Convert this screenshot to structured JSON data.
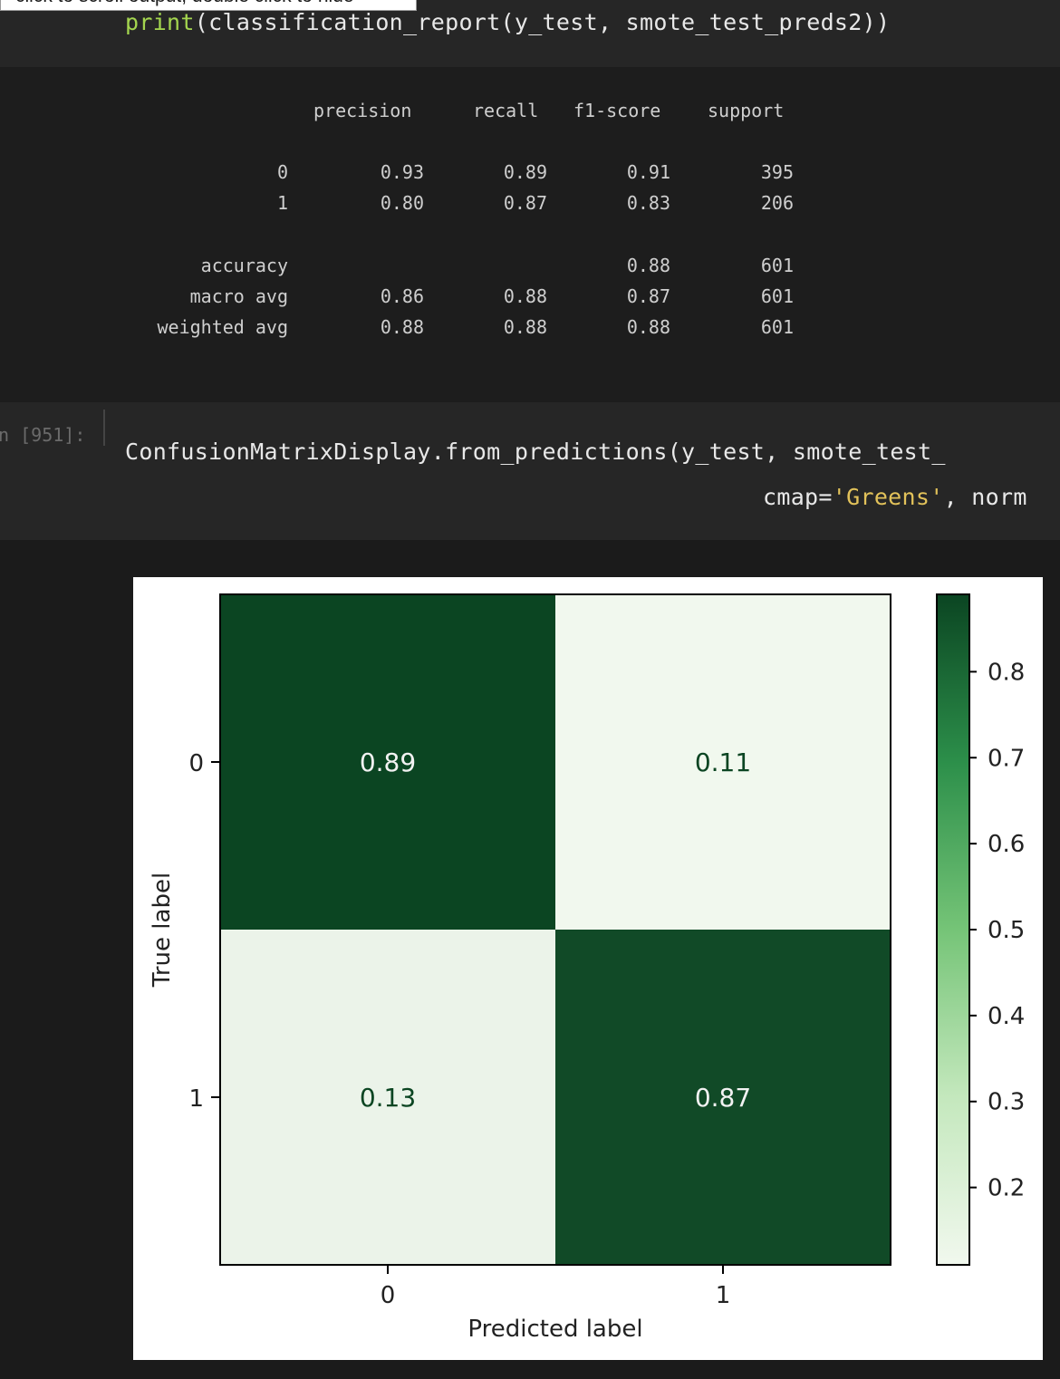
{
  "tooltip": "click to scroll output; double click to hide",
  "cell1": {
    "code_fn": "print",
    "code_rest": "(classification_report(y_test, smote_test_preds2))"
  },
  "report": {
    "headers": [
      "precision",
      "recall",
      "f1-score",
      "support"
    ],
    "rows": [
      {
        "label": "0",
        "precision": "0.93",
        "recall": "0.89",
        "f1": "0.91",
        "support": "395"
      },
      {
        "label": "1",
        "precision": "0.80",
        "recall": "0.87",
        "f1": "0.83",
        "support": "206"
      },
      {
        "label": "accuracy",
        "precision": "",
        "recall": "",
        "f1": "0.88",
        "support": "601"
      },
      {
        "label": "macro avg",
        "precision": "0.86",
        "recall": "0.88",
        "f1": "0.87",
        "support": "601"
      },
      {
        "label": "weighted avg",
        "precision": "0.88",
        "recall": "0.88",
        "f1": "0.88",
        "support": "601"
      }
    ]
  },
  "cell2": {
    "prompt": "In [951]:",
    "line1": "ConfusionMatrixDisplay.from_predictions(y_test, smote_test_",
    "line2_a": "cmap=",
    "line2_str": "'Greens'",
    "line2_b": ", norm"
  },
  "chart_data": {
    "type": "heatmap",
    "xlabel": "Predicted label",
    "ylabel": "True label",
    "x_ticks": [
      "0",
      "1"
    ],
    "y_ticks": [
      "0",
      "1"
    ],
    "matrix": [
      [
        0.89,
        0.11
      ],
      [
        0.13,
        0.87
      ]
    ],
    "cell_labels": [
      [
        "0.89",
        "0.11"
      ],
      [
        "0.13",
        "0.87"
      ]
    ],
    "colormap": "Greens",
    "colorbar_range": [
      0.11,
      0.89
    ],
    "colorbar_ticks": [
      "0.8",
      "0.7",
      "0.6",
      "0.5",
      "0.4",
      "0.3",
      "0.2"
    ],
    "colors": {
      "dark": "#0b4522",
      "light": "#f1f8ee",
      "dark_text": "#f2f2f2",
      "light_text": "#0b4522"
    }
  }
}
